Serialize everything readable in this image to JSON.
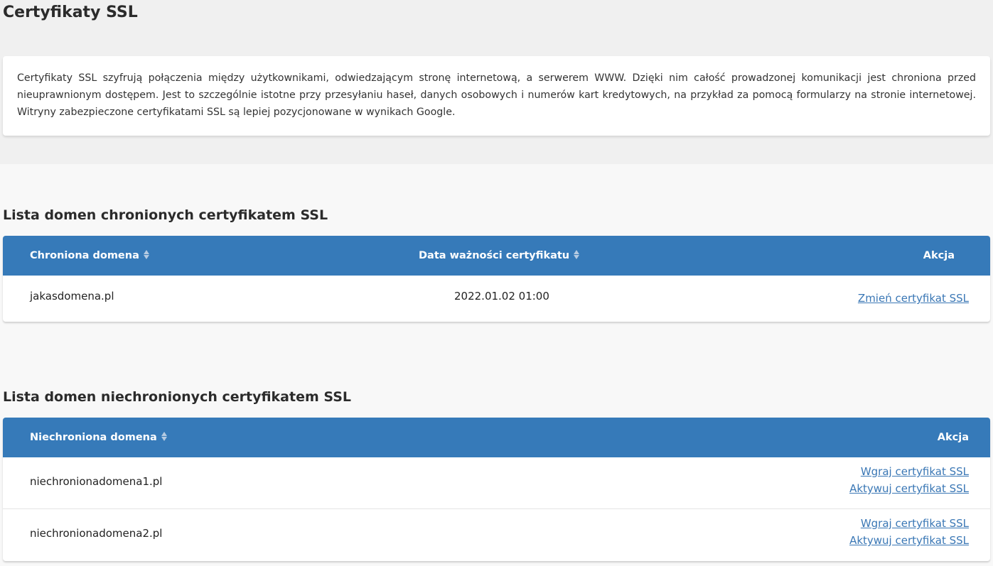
{
  "page": {
    "title": "Certyfikaty SSL",
    "intro": "Certyfikaty SSL szyfrują połączenia między użytkownikami, odwiedzającym stronę internetową, a serwerem WWW. Dzięki nim całość prowadzonej komunikacji jest chroniona przed nieuprawnionym dostępem. Jest to szczególnie istotne przy przesyłaniu haseł, danych osobowych i numerów kart kredytowych, na przykład za pomocą formularzy na stronie internetowej. Witryny zabezpieczone certyfikatami SSL są lepiej pozycjonowane w wynikach Google."
  },
  "protected": {
    "title": "Lista domen chronionych certyfikatem SSL",
    "columns": {
      "domain": "Chroniona domena",
      "expiry": "Data ważności certyfikatu",
      "action": "Akcja"
    },
    "rows": [
      {
        "domain": "jakasdomena.pl",
        "expiry": "2022.01.02 01:00",
        "action": "Zmień certyfikat SSL"
      }
    ]
  },
  "unprotected": {
    "title": "Lista domen niechronionych certyfikatem SSL",
    "columns": {
      "domain": "Niechroniona domena",
      "action": "Akcja"
    },
    "rows": [
      {
        "domain": "niechronionadomena1.pl",
        "upload": "Wgraj certyfikat SSL",
        "activate": "Aktywuj certyfikat SSL"
      },
      {
        "domain": "niechronionadomena2.pl",
        "upload": "Wgraj certyfikat SSL",
        "activate": "Aktywuj certyfikat SSL"
      }
    ]
  },
  "colors": {
    "header_bg": "#367ab9",
    "link": "#3a77b5"
  },
  "icons": {
    "sort": "sort-icon"
  }
}
